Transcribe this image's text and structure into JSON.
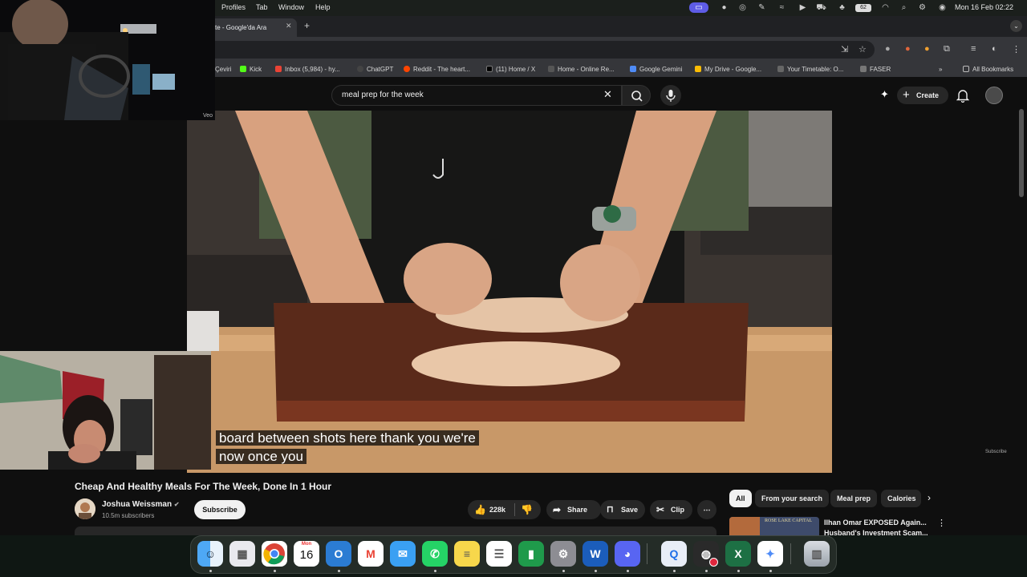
{
  "menubar": {
    "items": [
      "Profiles",
      "Tab",
      "Window",
      "Help"
    ],
    "clock": "Mon 16 Feb  02:22",
    "battery": "62"
  },
  "tabs": {
    "active_title": "te - Google'da Ara"
  },
  "bookmarks": [
    {
      "label": "Çeviri",
      "color": "#4285f4"
    },
    {
      "label": "Kick",
      "color": "#53fc18"
    },
    {
      "label": "Inbox (5,984) - hy...",
      "color": "#ea4335"
    },
    {
      "label": "ChatGPT",
      "color": "#555555"
    },
    {
      "label": "Reddit - The heart...",
      "color": "#ff4500"
    },
    {
      "label": "(11) Home / X",
      "color": "#000000"
    },
    {
      "label": "Home - Online Re...",
      "color": "#666666"
    },
    {
      "label": "Google Gemini",
      "color": "#4f8cf7"
    },
    {
      "label": "My Drive - Google...",
      "color": "#fbbc04"
    },
    {
      "label": "Your Timetable: O...",
      "color": "#777777"
    },
    {
      "label": "FASER",
      "color": "#888888"
    }
  ],
  "bookmarks_all": "All Bookmarks",
  "youtube": {
    "search_query": "meal prep for the week",
    "create_label": "Create",
    "subtitle_line1": "board between shots here thank you we're",
    "subtitle_line2": "now once you",
    "subscribe_watermark": "Subscribe",
    "video_title": "Cheap And Healthy Meals For The Week, Done In 1 Hour",
    "channel_name": "Joshua Weissman",
    "subscriber_count": "10.5m subscribers",
    "subscribe_label": "Subscribe",
    "like_count": "228k",
    "share_label": "Share",
    "save_label": "Save",
    "clip_label": "Clip",
    "chips": [
      "All",
      "From your search",
      "Meal prep",
      "Calories"
    ],
    "rec_thumb_text": "ROSE LAKE CAPITAL",
    "rec_title_line1": "Ilhan Omar EXPOSED Again...",
    "rec_title_line2": "Husband's Investment Scam..."
  },
  "cam_top_label": "Veo",
  "dock": {
    "calendar_month": "Mon",
    "calendar_day": "16",
    "apps": [
      "finder",
      "launchpad",
      "chrome",
      "calendar",
      "outlook",
      "gmail",
      "mail",
      "whatsapp",
      "notes",
      "reminders",
      "numbers",
      "settings",
      "word",
      "discord",
      "quicktime",
      "obs",
      "excel",
      "gemini",
      "trash"
    ]
  },
  "colors": {
    "yt_bg": "#0f0f0f",
    "chip_active": "#f1f1f1",
    "pill_bg": "#272727",
    "macos_accent": "#5e5ce6"
  }
}
